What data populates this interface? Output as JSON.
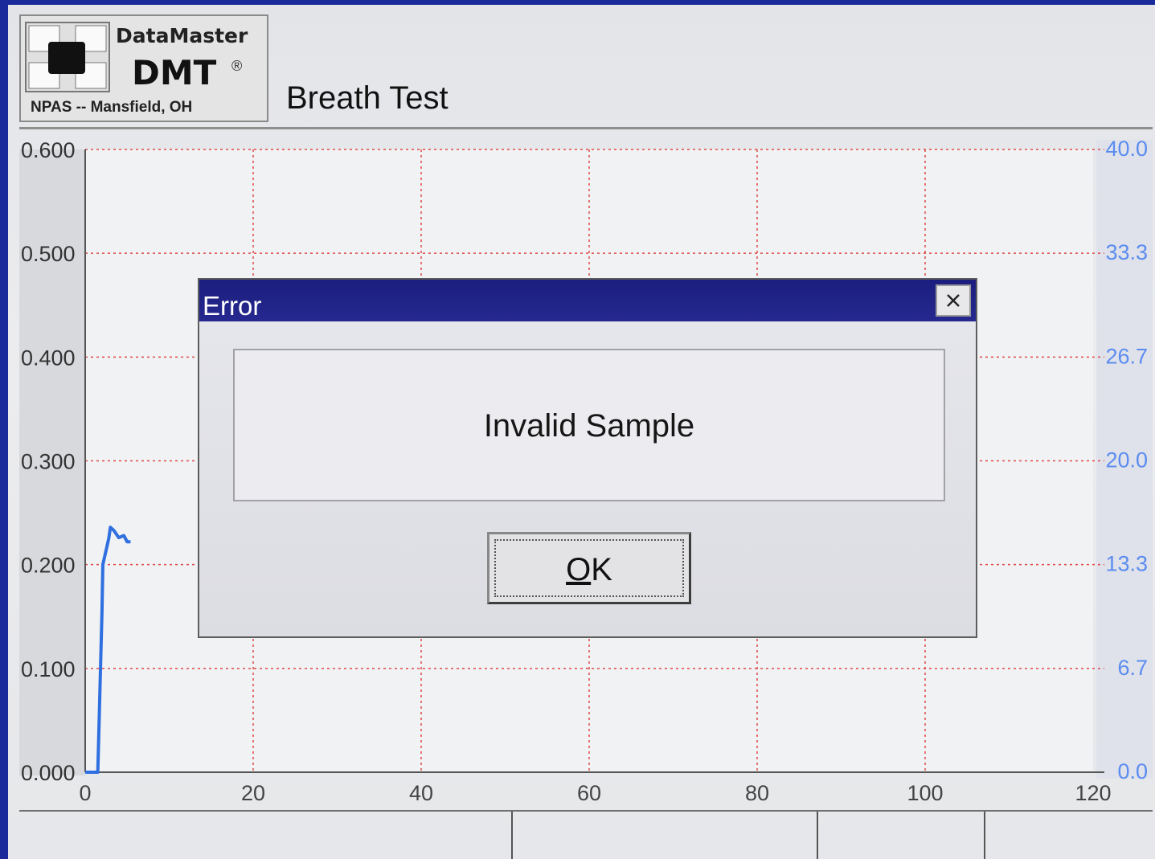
{
  "header": {
    "logo_name": "DataMaster",
    "logo_model": "DMT",
    "logo_reg": "®",
    "logo_location": "NPAS -- Mansfield, OH",
    "title": "Breath Test"
  },
  "colors": {
    "frame": "#1a2a9a",
    "dialog_titlebar": "#1b1e7e",
    "grid": "#e04a4a",
    "trace": "#2f6fe0",
    "right_axis": "#5b8cf0"
  },
  "chart_data": {
    "type": "line",
    "x_ticks": [
      "0",
      "20",
      "40",
      "60",
      "80",
      "100",
      "120"
    ],
    "y_ticks_left": [
      "0.000",
      "0.100",
      "0.200",
      "0.300",
      "0.400",
      "0.500",
      "0.600"
    ],
    "y_ticks_right": [
      "0.0",
      "6.7",
      "13.3",
      "20.0",
      "26.7",
      "33.3",
      "40.0"
    ],
    "xlim": [
      0,
      120
    ],
    "ylim": [
      0,
      0.6
    ],
    "y2lim": [
      0,
      40
    ],
    "grid": true,
    "series": [
      {
        "x": [
          0,
          1.5,
          2.0,
          2.1,
          2.8,
          3.0,
          3.4,
          4.0,
          4.6,
          5.0,
          5.4
        ],
        "y": [
          0.0,
          0.0,
          0.155,
          0.2,
          0.225,
          0.236,
          0.233,
          0.226,
          0.228,
          0.222,
          0.222
        ]
      }
    ]
  },
  "dialog": {
    "title": "Error",
    "close_icon": "close-icon",
    "message": "Invalid Sample",
    "ok_mnemonic": "O",
    "ok_rest": "K"
  },
  "status_bar": {
    "segments": [
      "",
      "",
      "",
      ""
    ]
  }
}
